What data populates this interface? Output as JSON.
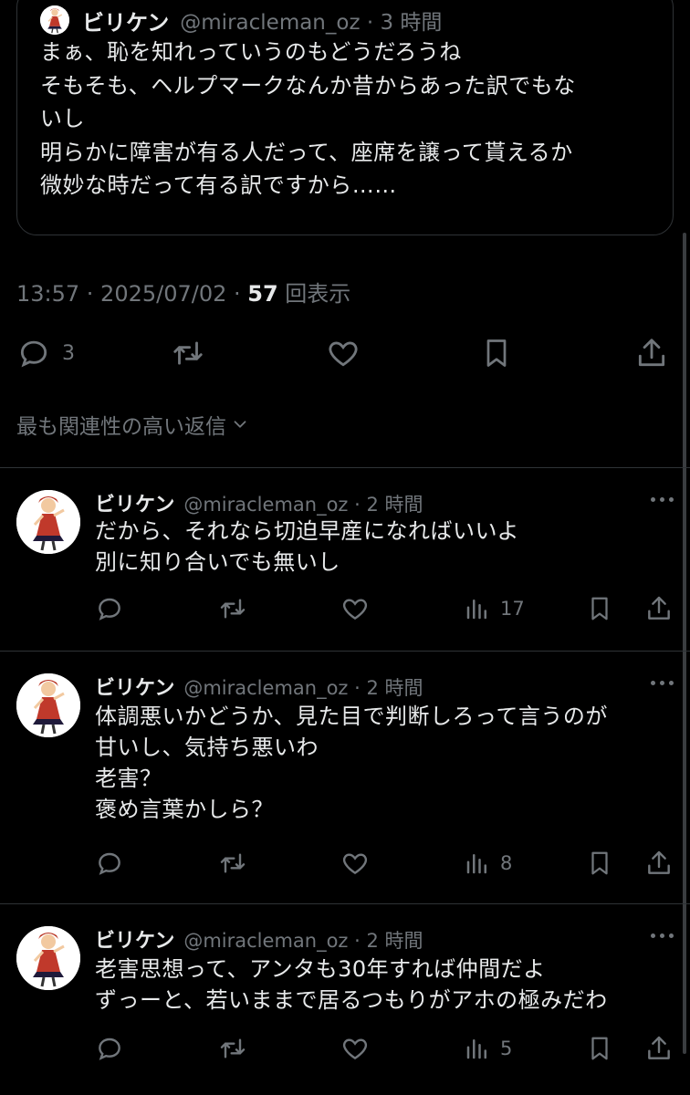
{
  "quoted_tweet": {
    "name": "ビリケン",
    "handle_time": "@miracleman_oz · 3 時間",
    "lines": [
      "まぁ、恥を知れっていうのもどうだろうね",
      "そもそも、ヘルプマークなんか昔からあった訳でもな",
      "いし",
      "明らかに障害が有る人だって、座席を譲って貰えるか",
      "微妙な時だって有る訳ですから……"
    ]
  },
  "meta": {
    "timestamp": "13:57 · 2025/07/02 · ",
    "views_count": "57",
    "views_label": " 回表示"
  },
  "actions": {
    "reply_count": "3"
  },
  "sort": {
    "label": "最も関連性の高い返信"
  },
  "replies": [
    {
      "name": "ビリケン",
      "handle_time": "@miracleman_oz · 2 時間",
      "lines": [
        "だから、それなら切迫早産になればいいよ",
        "別に知り合いでも無いし"
      ],
      "views": "17"
    },
    {
      "name": "ビリケン",
      "handle_time": "@miracleman_oz · 2 時間",
      "lines": [
        "体調悪いかどうか、見た目で判断しろって言うのが",
        "甘いし、気持ち悪いわ",
        "老害？",
        "褒め言葉かしら？"
      ],
      "views": "8"
    },
    {
      "name": "ビリケン",
      "handle_time": "@miracleman_oz · 2 時間",
      "lines": [
        "老害思想って、アンタも30年すれば仲間だよ",
        "ずっーと、若いままで居るつもりがアホの極みだわ"
      ],
      "views": "5"
    }
  ],
  "colors": {
    "background": "#000000",
    "text": "#e7e9ea",
    "muted": "#71767b",
    "border": "#2f3336"
  }
}
